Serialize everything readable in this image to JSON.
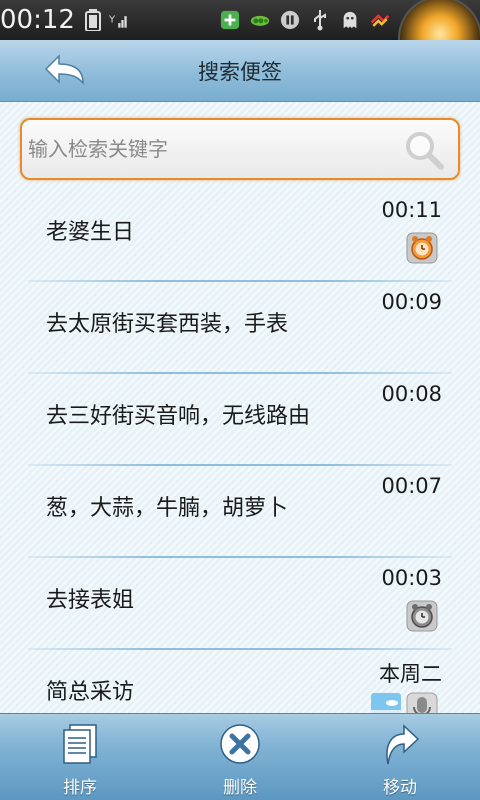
{
  "status_bar": {
    "time": "00:12",
    "icons": [
      "battery-icon",
      "signal-icon",
      "app-plus-icon",
      "peapod-icon",
      "pause-icon",
      "usb-icon",
      "ghost-icon",
      "ribbon-icon"
    ]
  },
  "header": {
    "title": "搜索便签",
    "back_icon": "back-arrow-icon"
  },
  "search": {
    "placeholder": "输入检索关键字",
    "value": ""
  },
  "notes": [
    {
      "title": "老婆生日",
      "time": "00:11",
      "icons": [
        "alarm-orange-icon"
      ]
    },
    {
      "title": "去太原街买套西装，手表",
      "time": "00:09",
      "icons": []
    },
    {
      "title": "去三好街买音响，无线路由",
      "time": "00:08",
      "icons": []
    },
    {
      "title": "葱，大蒜，牛腩，胡萝卜",
      "time": "00:07",
      "icons": []
    },
    {
      "title": "去接表姐",
      "time": "00:03",
      "icons": [
        "alarm-gray-icon"
      ]
    },
    {
      "title": "简总采访",
      "time": "本周二",
      "icons": [
        "image-icon",
        "voice-icon"
      ]
    }
  ],
  "toolbar": {
    "sort_label": "排序",
    "delete_label": "删除",
    "move_label": "移动"
  },
  "colors": {
    "accent_border": "#e58b2a",
    "header_blue": "#8fbcd9",
    "toolbar_blue": "#7fb1d3"
  }
}
